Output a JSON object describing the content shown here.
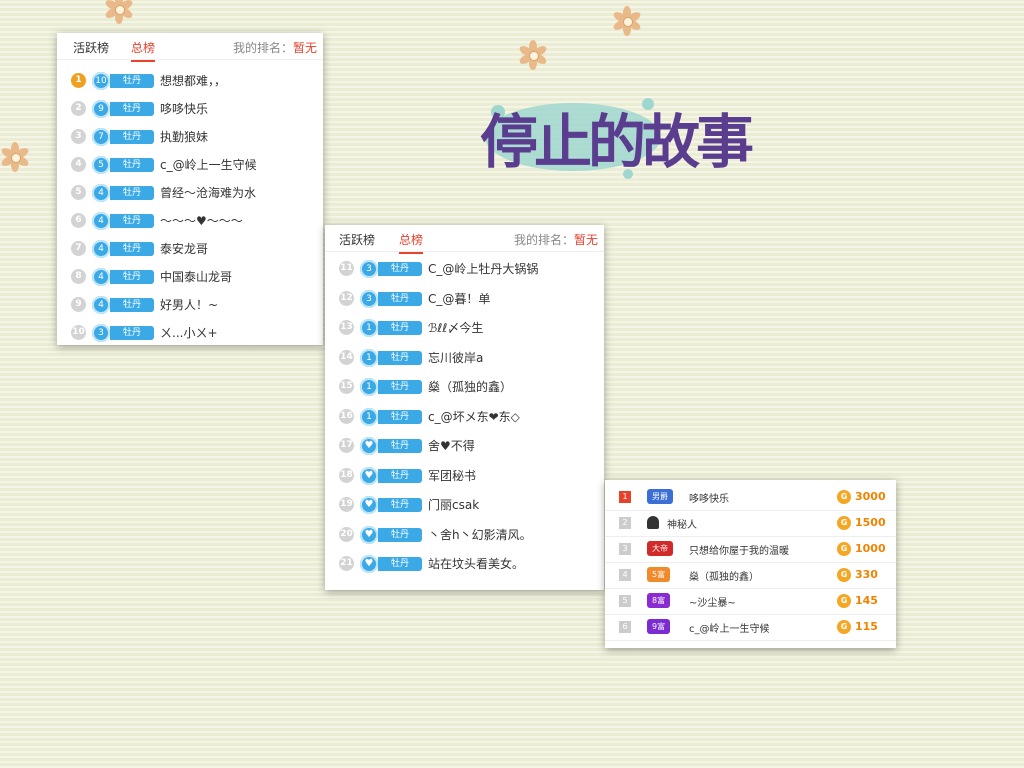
{
  "title": "停止的故事",
  "panel1": {
    "tabs": [
      "活跃榜",
      "总榜"
    ],
    "myrank_label": "我的排名：",
    "myrank_value": "暂无",
    "rows": [
      {
        "rank": "1",
        "level": "10",
        "tag": "牡丹",
        "name": "想想都难，，",
        "crown": true
      },
      {
        "rank": "2",
        "level": "9",
        "tag": "牡丹",
        "name": "哆哆快乐"
      },
      {
        "rank": "3",
        "level": "7",
        "tag": "牡丹",
        "name": "执勤狼妹"
      },
      {
        "rank": "4",
        "level": "5",
        "tag": "牡丹",
        "name": "c_@岭上一生守候"
      },
      {
        "rank": "5",
        "level": "4",
        "tag": "牡丹",
        "name": "曾经～沧海难为水"
      },
      {
        "rank": "6",
        "level": "4",
        "tag": "牡丹",
        "name": "～～～♥～～～"
      },
      {
        "rank": "7",
        "level": "4",
        "tag": "牡丹",
        "name": "泰安龙哥"
      },
      {
        "rank": "8",
        "level": "4",
        "tag": "牡丹",
        "name": "中国泰山龙哥"
      },
      {
        "rank": "9",
        "level": "4",
        "tag": "牡丹",
        "name": "好男人！~"
      },
      {
        "rank": "10",
        "level": "3",
        "tag": "牡丹",
        "name": "ㄨ...小ㄨ+"
      }
    ]
  },
  "panel2": {
    "tabs": [
      "活跃榜",
      "总榜"
    ],
    "myrank_label": "我的排名：",
    "myrank_value": "暂无",
    "rows": [
      {
        "rank": "11",
        "level": "3",
        "tag": "牡丹",
        "name": "C_@岭上牡丹大锅锅"
      },
      {
        "rank": "12",
        "level": "3",
        "tag": "牡丹",
        "name": "C_@暮！单"
      },
      {
        "rank": "13",
        "level": "1",
        "tag": "牡丹",
        "name": "ℬℓℓ〆今生"
      },
      {
        "rank": "14",
        "level": "1",
        "tag": "牡丹",
        "name": "忘川彼岸a"
      },
      {
        "rank": "15",
        "level": "1",
        "tag": "牡丹",
        "name": "燊（孤独的鑫）"
      },
      {
        "rank": "16",
        "level": "1",
        "tag": "牡丹",
        "name": "c_@坏メ东❤东◇"
      },
      {
        "rank": "17",
        "level": "♥",
        "tag": "牡丹",
        "name": "舍♥不得"
      },
      {
        "rank": "18",
        "level": "♥",
        "tag": "牡丹",
        "name": "军团秘书"
      },
      {
        "rank": "19",
        "level": "♥",
        "tag": "牡丹",
        "name": "门丽csak"
      },
      {
        "rank": "20",
        "level": "♥",
        "tag": "牡丹",
        "name": "丶舍h丶幻影清风。"
      },
      {
        "rank": "21",
        "level": "♥",
        "tag": "牡丹",
        "name": "站在坟头看美女。"
      }
    ]
  },
  "panel3": {
    "rows": [
      {
        "rank": "1",
        "badge": "男爵",
        "badge_color": "#3b6fd6",
        "name": "哆哆快乐",
        "score": "3000"
      },
      {
        "rank": "2",
        "badge": "",
        "badge_color": "",
        "name": "神秘人",
        "score": "1500"
      },
      {
        "rank": "3",
        "badge": "大帝",
        "badge_color": "#d22a2a",
        "name": "只想给你屋于我的温暖",
        "score": "1000"
      },
      {
        "rank": "4",
        "badge": "5富",
        "badge_color": "#f08a2b",
        "name": "燊（孤独的鑫）",
        "score": "330"
      },
      {
        "rank": "5",
        "badge": "8富",
        "badge_color": "#8a2bd2",
        "name": "~沙尘暴~",
        "score": "145"
      },
      {
        "rank": "6",
        "badge": "9富",
        "badge_color": "#7a2bd2",
        "name": "c_@岭上一生守候",
        "score": "115"
      }
    ],
    "coin_glyph": "G"
  },
  "colors": {
    "accent": "#e8412c",
    "tag": "#3aa9e6",
    "score": "#f08300"
  }
}
